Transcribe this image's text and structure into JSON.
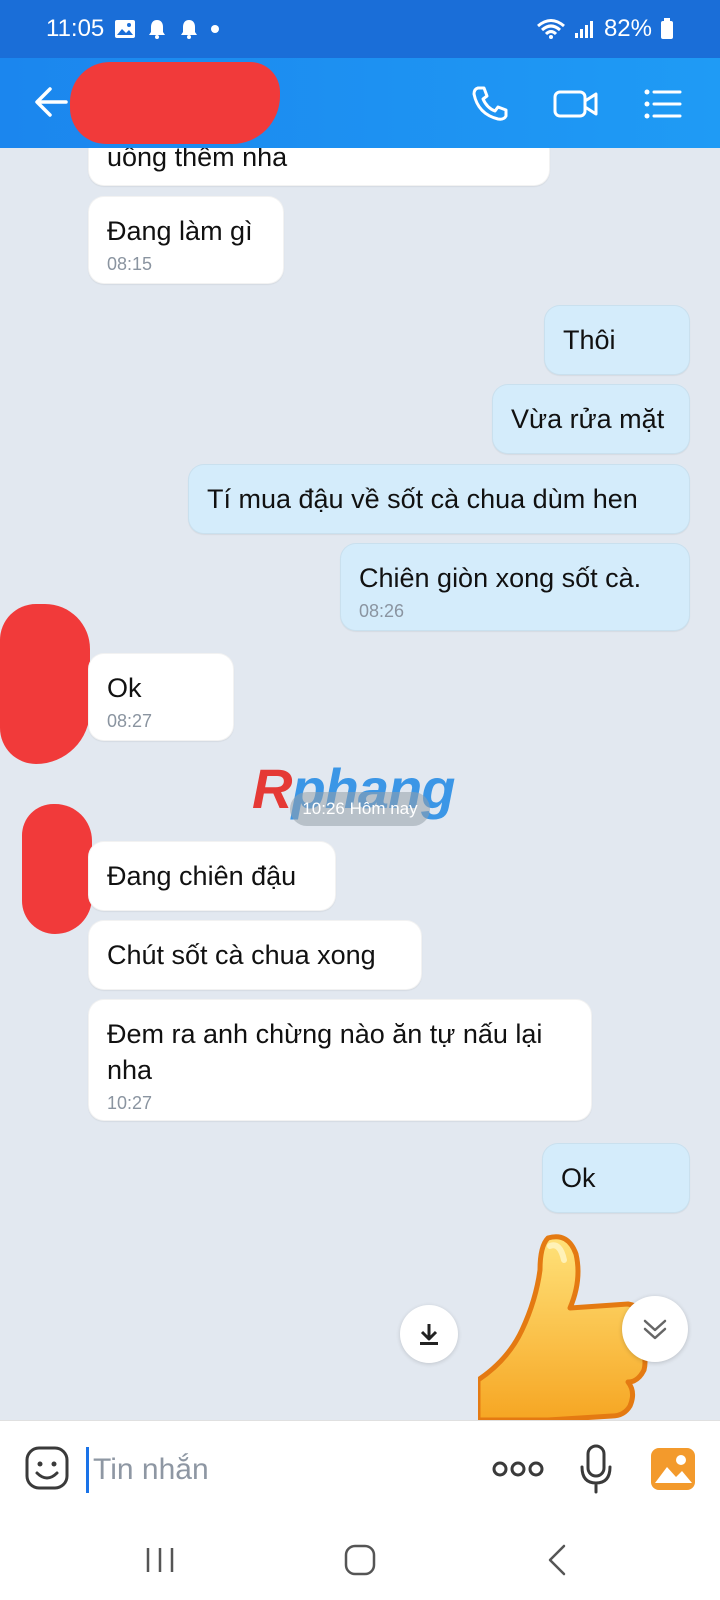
{
  "status_bar": {
    "time": "11:05",
    "battery": "82%"
  },
  "header": {
    "icons": [
      "back-arrow-icon",
      "phone-icon",
      "video-icon",
      "menu-list-icon"
    ]
  },
  "messages": [
    {
      "side": "in",
      "text": "uống thêm nha",
      "time": ""
    },
    {
      "side": "in",
      "text": "Đang làm gì",
      "time": "08:15"
    },
    {
      "side": "out",
      "text": "Thôi",
      "time": ""
    },
    {
      "side": "out",
      "text": "Vừa rửa mặt",
      "time": ""
    },
    {
      "side": "out",
      "text": "Tí mua đậu về sốt cà chua dùm hen",
      "time": ""
    },
    {
      "side": "out",
      "text": "Chiên giòn xong sốt cà.",
      "time": "08:26"
    },
    {
      "side": "in",
      "text": "Ok",
      "time": "08:27"
    },
    {
      "side": "in",
      "text": "Đang chiên đậu",
      "time": ""
    },
    {
      "side": "in",
      "text": "Chút sốt cà chua xong",
      "time": ""
    },
    {
      "side": "in",
      "text": "Đem ra anh chừng nào ăn tự nấu lại nha",
      "time": "10:27"
    },
    {
      "side": "out",
      "text": "Ok",
      "time": ""
    }
  ],
  "date_separator": "10:26 Hôm nay",
  "watermark": {
    "first": "R",
    "rest": "phang"
  },
  "input": {
    "placeholder": "Tin nhắn"
  },
  "colors": {
    "header": "#1b86ee",
    "out_bubble": "#d4ecfb",
    "in_bubble": "#ffffff",
    "redaction": "#f13a3a"
  }
}
